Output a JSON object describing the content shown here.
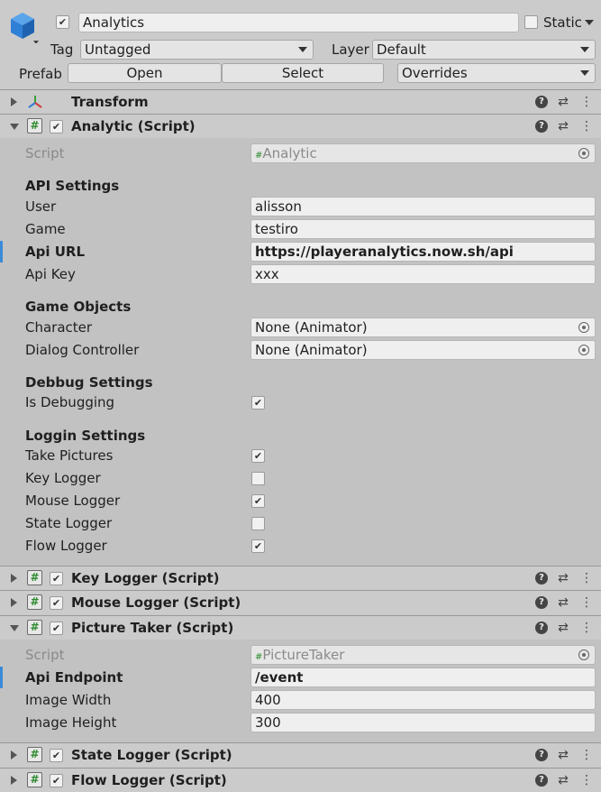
{
  "header": {
    "object_name": "Analytics",
    "active_checked": "✔",
    "static_label": "Static",
    "tag_label": "Tag",
    "tag_value": "Untagged",
    "layer_label": "Layer",
    "layer_value": "Default",
    "prefab_label": "Prefab",
    "open_label": "Open",
    "select_label": "Select",
    "overrides_label": "Overrides"
  },
  "components": {
    "transform": {
      "title": "Transform"
    },
    "analytic": {
      "title": "Analytic (Script)",
      "script_label": "Script",
      "script_value": "Analytic",
      "api_settings": "API Settings",
      "user_label": "User",
      "user_value": "alisson",
      "game_label": "Game",
      "game_value": "testiro",
      "api_url_label": "Api URL",
      "api_url_value": "https://playeranalytics.now.sh/api",
      "api_key_label": "Api Key",
      "api_key_value": "xxx",
      "game_objects": "Game Objects",
      "character_label": "Character",
      "character_value": "None (Animator)",
      "dialog_label": "Dialog Controller",
      "dialog_value": "None (Animator)",
      "debug_settings": "Debbug Settings",
      "is_debugging_label": "Is Debugging",
      "is_debugging": true,
      "loggin_settings": "Loggin Settings",
      "take_pictures_label": "Take Pictures",
      "take_pictures": true,
      "key_logger_label": "Key Logger",
      "key_logger": false,
      "mouse_logger_label": "Mouse Logger",
      "mouse_logger": true,
      "state_logger_label": "State Logger",
      "state_logger": false,
      "flow_logger_label": "Flow Logger",
      "flow_logger": true
    },
    "key_logger": {
      "title": "Key Logger (Script)"
    },
    "mouse_logger": {
      "title": "Mouse Logger (Script)"
    },
    "picture_taker": {
      "title": "Picture Taker (Script)",
      "script_label": "Script",
      "script_value": "PictureTaker",
      "api_endpoint_label": "Api Endpoint",
      "api_endpoint_value": "/event",
      "image_width_label": "Image Width",
      "image_width_value": "400",
      "image_height_label": "Image Height",
      "image_height_value": "300"
    },
    "state_logger": {
      "title": "State Logger (Script)"
    },
    "flow_logger": {
      "title": "Flow Logger (Script)"
    }
  },
  "icons": {
    "check": "✔",
    "help": "?",
    "settings": "⇄",
    "more": "⋮",
    "hash": "#"
  },
  "colors": {
    "modified_marker": "#3a8ad8",
    "script_icon_green": "#2d8a2d",
    "cube_blue": "#2f7fd6"
  }
}
